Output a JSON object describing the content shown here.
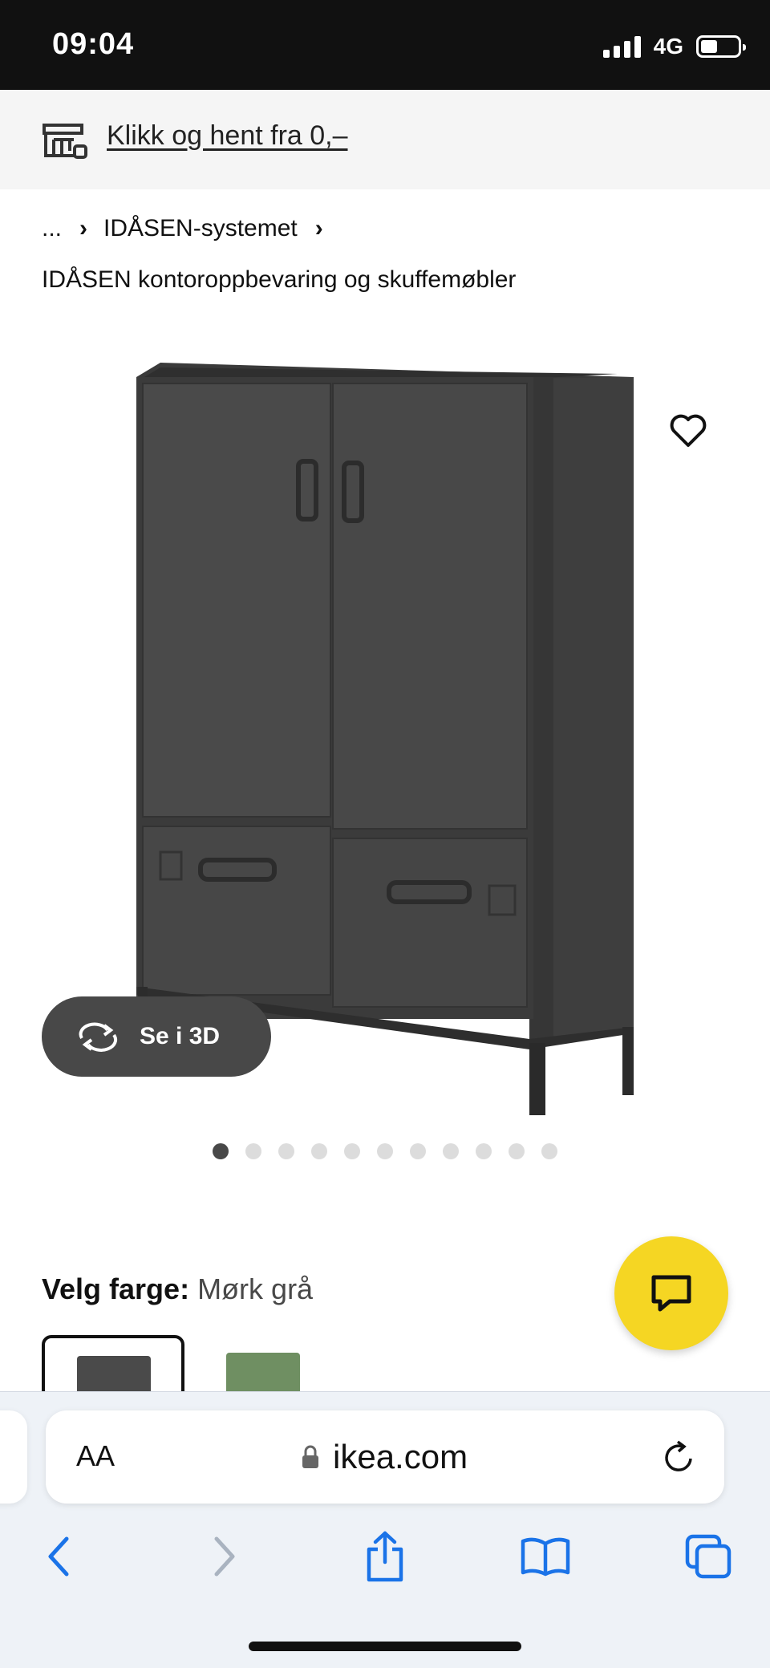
{
  "status_bar": {
    "time": "09:04",
    "network": "4G",
    "battery_level": 0.45
  },
  "promo": {
    "icon": "store-pickup-icon",
    "link_text": "Klikk og hent fra 0,–"
  },
  "breadcrumb": {
    "ellipsis": "...",
    "separator": "›",
    "items": [
      {
        "label": "IDÅSEN-systemet"
      }
    ]
  },
  "product": {
    "category": "IDÅSEN kontoroppbevaring og skuffemøbler",
    "image": "dark-grey-cabinet-with-doors-and-drawers",
    "favorite_icon": "heart-outline-icon",
    "view_3d_label": "Se i 3D",
    "view_3d_icon": "rotate-arrows-icon"
  },
  "carousel": {
    "total": 11,
    "active_index": 0
  },
  "color_selection": {
    "label": "Velg farge:",
    "value": "Mørk grå",
    "swatches": [
      {
        "name": "Mørk grå",
        "color": "#4a4a4a",
        "selected": true
      },
      {
        "name": "Grønn",
        "color": "#6f8f62",
        "selected": false
      }
    ]
  },
  "chat": {
    "icon": "chat-bubble-icon",
    "color": "#f5d623"
  },
  "safari": {
    "aa_label": "AA",
    "url": "ikea.com",
    "lock_icon": "lock-icon",
    "reload_icon": "reload-icon",
    "toolbar": {
      "back_icon": "chevron-left-icon",
      "forward_icon": "chevron-right-icon",
      "share_icon": "share-icon",
      "bookmarks_icon": "book-icon",
      "tabs_icon": "tabs-icon"
    },
    "accent": "#1a73e8"
  }
}
